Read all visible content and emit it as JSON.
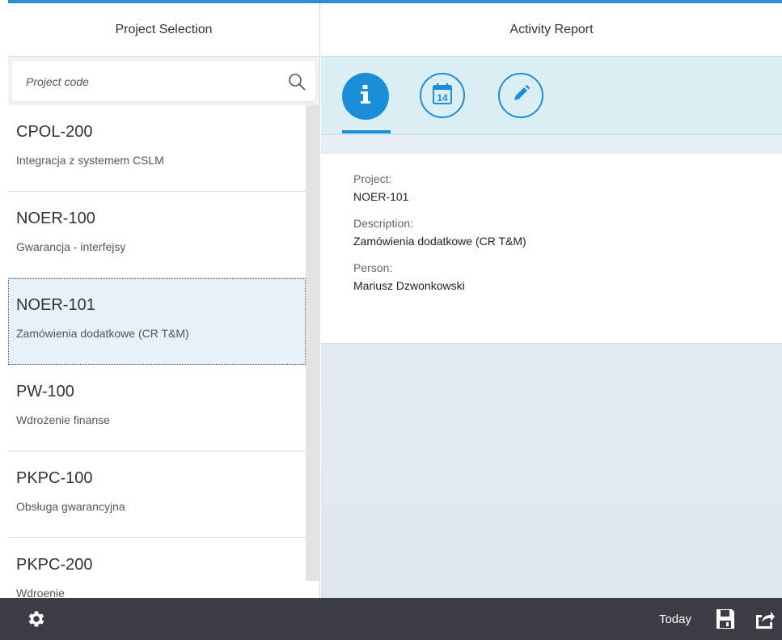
{
  "master": {
    "title": "Project Selection",
    "search": {
      "placeholder": "Project code",
      "value": ""
    },
    "items": [
      {
        "code": "CPOL-200",
        "description": "Integracja z systemem CSLM"
      },
      {
        "code": "NOER-100",
        "description": "Gwarancja - interfejsy"
      },
      {
        "code": "NOER-101",
        "description": "Zamówienia dodatkowe (CR T&M)"
      },
      {
        "code": "PW-100",
        "description": "Wdrożenie finanse"
      },
      {
        "code": "PKPC-100",
        "description": "Obsługa gwarancyjna"
      },
      {
        "code": "PKPC-200",
        "description": "Wdroenie"
      }
    ],
    "selected_index": 2
  },
  "detail": {
    "title": "Activity Report",
    "tabs": [
      {
        "icon": "info-icon",
        "active": true
      },
      {
        "icon": "calendar-icon",
        "calendar_day": "14",
        "active": false
      },
      {
        "icon": "pencil-icon",
        "active": false
      }
    ],
    "fields": {
      "project_label": "Project:",
      "project_value": "NOER-101",
      "description_label": "Description:",
      "description_value": "Zamówienia dodatkowe (CR T&M)",
      "person_label": "Person:",
      "person_value": "Mariusz Dzwonkowski"
    }
  },
  "footer": {
    "today_label": "Today",
    "icons": [
      "gear-icon",
      "save-icon",
      "share-icon"
    ]
  },
  "colors": {
    "accent": "#1a8ed8",
    "top_bar": "#2c8fd6",
    "footer_bg": "#3a3e44",
    "selected_row": "#e6f1fa",
    "tabbar_bg": "#dbeef3"
  }
}
